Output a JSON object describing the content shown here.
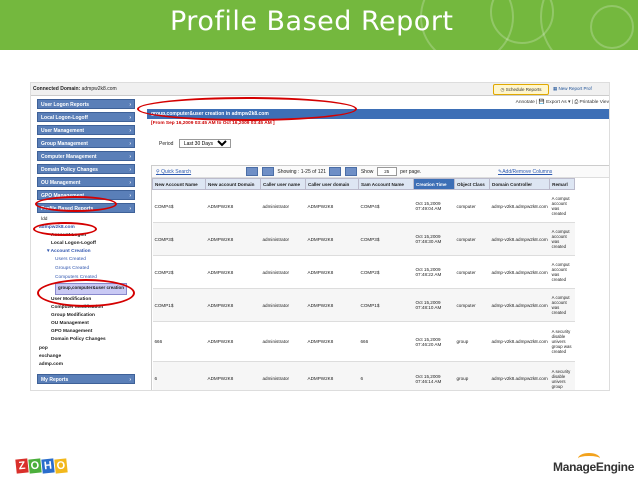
{
  "slide_title": "Profile Based Report",
  "connected_domain": {
    "label": "Connected Domain:",
    "value": "admpw2k8.com"
  },
  "buttons": {
    "schedule": "Schedule Reports",
    "new_report": "New Report Prof"
  },
  "actions": {
    "annotate": "Annotate |",
    "export": "Export As ▾ |",
    "printable": "Printable Viev"
  },
  "sidebar": {
    "top_items": [
      "User Logon Reports",
      "Local Logon-Logoff",
      "User Management",
      "Group Management",
      "Computer Management",
      "Domain Policy Changes",
      "OU Management",
      "GPO Management",
      "Profile Based Reports"
    ],
    "tree": {
      "l1": "ldd",
      "domain": "admpw2k8.com",
      "account_logon": "Account Logon",
      "local_logon": "Local Logon-Logoff",
      "account_creation": "Account Creation",
      "users_created": "Users Created",
      "groups_created": "Groups Created",
      "computers_created": "Computers Created",
      "selected": "group,computer&user creation",
      "user_mod": "User Modification",
      "computer_mod": "Computer Modification",
      "group_mod": "Group Modification",
      "ou_mgmt": "OU Management",
      "gpo_mgmt": "GPO Management",
      "domain_policy": "Domain Policy Changes",
      "pop": "pop",
      "exchange": "exchange",
      "admp": "admp.com"
    },
    "my_reports": "My Reports"
  },
  "report": {
    "title": "group,computer&user creation in admpw2k8.com",
    "range": "[From Sep 16,2009 03:45 AM to Oct 16,2009 03:45 AM ]",
    "period_label": "Period",
    "period_value": "Last 30 Days",
    "quick_search": "Quick Search",
    "showing": "Showing : 1-25 of 121",
    "show_label": "Show",
    "per_page": "25",
    "per_page_suffix": "per page.",
    "add_remove": "Add/Remove Columns",
    "columns": [
      "New Account Name",
      "New account Domain",
      "Caller user name",
      "Caller user domain",
      "Sam Account Name",
      "Creation Time",
      "Object Class",
      "Domain Controller",
      "Remarl"
    ],
    "rows": [
      {
        "name": "COMP4$",
        "domain": "ADMPW2K8",
        "caller": "administrator",
        "cdomain": "ADMPW2K8",
        "sam": "COMP4$",
        "time": "Oct 15,2009 07:49:04 AM",
        "class": "computer",
        "dc": "admp-v2k8.admpw2k8.com",
        "remark": "A comput account was created"
      },
      {
        "name": "COMP3$",
        "domain": "ADMPW2K8",
        "caller": "administrator",
        "cdomain": "ADMPW2K8",
        "sam": "COMP3$",
        "time": "Oct 15,2009 07:48:30 AM",
        "class": "computer",
        "dc": "admp-v2k8.admpw2k8.com",
        "remark": "A comput account was created"
      },
      {
        "name": "COMP2$",
        "domain": "ADMPW2K8",
        "caller": "administrator",
        "cdomain": "ADMPW2K8",
        "sam": "COMP2$",
        "time": "Oct 15,2009 07:48:22 AM",
        "class": "computer",
        "dc": "admp-v2k8.admpw2k8.com",
        "remark": "A comput account was created"
      },
      {
        "name": "COMP1$",
        "domain": "ADMPW2K8",
        "caller": "administrator",
        "cdomain": "ADMPW2K8",
        "sam": "COMP1$",
        "time": "Oct 15,2009 07:48:10 AM",
        "class": "computer",
        "dc": "admp-v2k8.admpw2k8.com",
        "remark": "A comput account was created"
      },
      {
        "name": "666",
        "domain": "ADMPW2K8",
        "caller": "administrator",
        "cdomain": "ADMPW2K8",
        "sam": "666",
        "time": "Oct 15,2009 07:46:20 AM",
        "class": "group",
        "dc": "admp-v2k8.admpw2k8.com",
        "remark": "A security disable univers group was created"
      },
      {
        "name": "6",
        "domain": "ADMPW2K8",
        "caller": "administrator",
        "cdomain": "ADMPW2K8",
        "sam": "6",
        "time": "Oct 15,2009 07:46:14 AM",
        "class": "group",
        "dc": "admp-v2k8.admpw2k8.com",
        "remark": "A security disable univers group"
      }
    ]
  },
  "footer": {
    "zoho_letters": [
      "Z",
      "O",
      "H",
      "O"
    ],
    "manage_engine": "ManageEngine"
  },
  "colors": {
    "banner": "#74b83e",
    "sidebar": "#5a7fb8",
    "header": "#3d6fb6",
    "highlight": "#d40000"
  }
}
